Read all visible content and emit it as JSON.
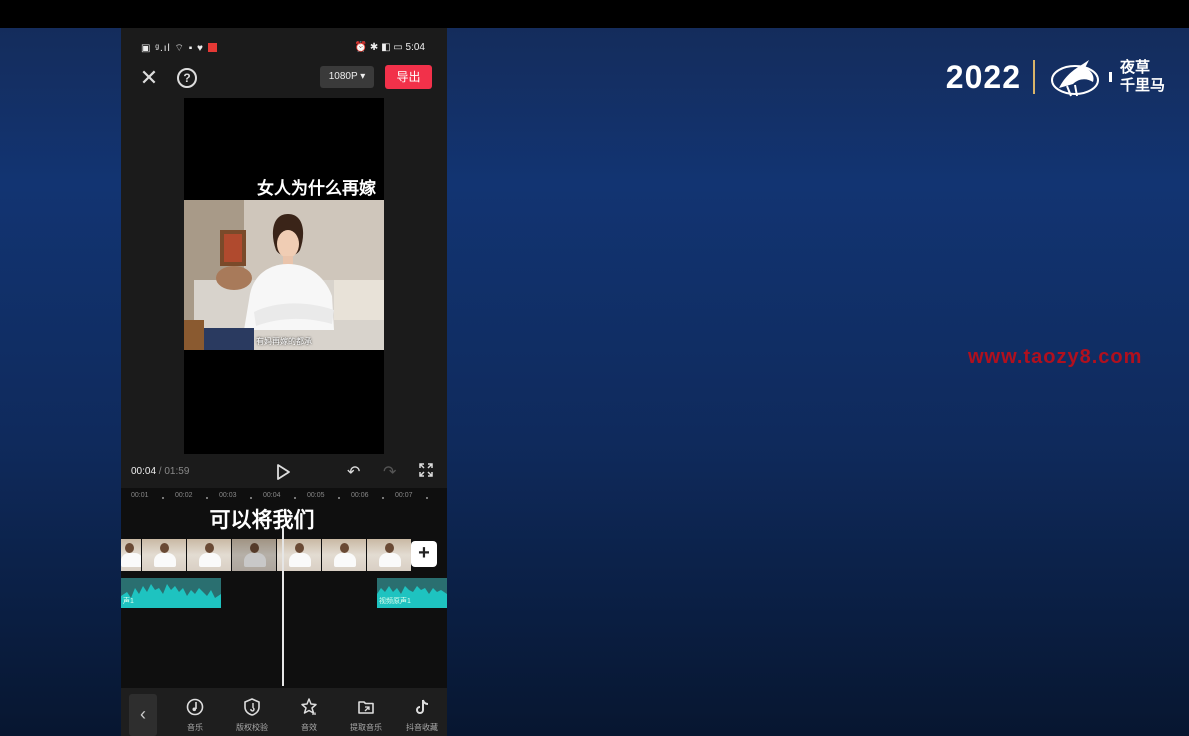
{
  "brand": {
    "year": "2022",
    "logo_line1": "夜草",
    "logo_line2": "千里马"
  },
  "watermark": "www.taozy8.com",
  "phone": {
    "status": {
      "left": "▣ ᵍ.ıl ⌔ ▪ ♥",
      "right": "⏰ ✱ ◧ ▭ 5:04"
    },
    "resolution": "1080P ▾",
    "export": "导出",
    "preview": {
      "caption": "女人为什么再嫁",
      "subtitle": "有妈再嫁的都承"
    },
    "time": {
      "current": "00:04",
      "total": " / 01:59"
    },
    "ruler_ticks": [
      "00:01",
      "00:02",
      "00:03",
      "00:04",
      "00:05",
      "00:06",
      "00:07"
    ],
    "lyric": "可以将我们",
    "audio_labels": [
      "声1",
      "视频原声1"
    ],
    "tools": [
      {
        "icon": "music-icon",
        "label": "音乐"
      },
      {
        "icon": "copyright-check-icon",
        "label": "版权校验"
      },
      {
        "icon": "sound-effect-icon",
        "label": "音效"
      },
      {
        "icon": "extract-music-icon",
        "label": "提取音乐"
      },
      {
        "icon": "tiktok-favorites-icon",
        "label": "抖音收藏"
      }
    ]
  },
  "colors": {
    "export": "#f2314a",
    "watermark": "#b0101e",
    "audio": "#2a6f70",
    "bg": "#123472"
  }
}
